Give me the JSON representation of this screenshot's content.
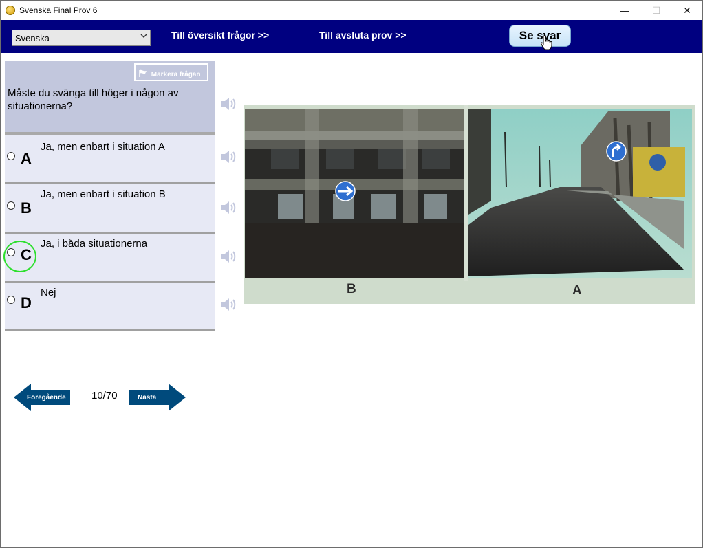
{
  "window": {
    "title": "Svenska Final Prov 6"
  },
  "titlebar_buttons": {
    "minimize": "—",
    "maximize": "☐",
    "close": "✕"
  },
  "toolbar": {
    "language": "Svenska",
    "link_overview": "Till översikt frågor >>",
    "link_finish": "Till avsluta prov  >>",
    "show_answer": "Se svar"
  },
  "question": {
    "mark_label": "Markera frågan",
    "text": "Måste du svänga till höger i någon av situationerna?"
  },
  "answers": [
    {
      "letter": "A",
      "text": "Ja, men enbart i situation A"
    },
    {
      "letter": "B",
      "text": "Ja, men enbart i situation B"
    },
    {
      "letter": "C",
      "text": "Ja, i båda situationerna"
    },
    {
      "letter": "D",
      "text": "Nej"
    }
  ],
  "photo": {
    "label_left": "B",
    "label_right": "A"
  },
  "navigation": {
    "previous": "Föregående",
    "next": "Nästa",
    "counter": "10/70"
  },
  "colors": {
    "toolbar": "#000080",
    "question_bg": "#c2c7dd",
    "answer_bg": "#e7e9f5",
    "nav_arrow": "#004a7c",
    "focus_ring": "#2ddf2d"
  }
}
